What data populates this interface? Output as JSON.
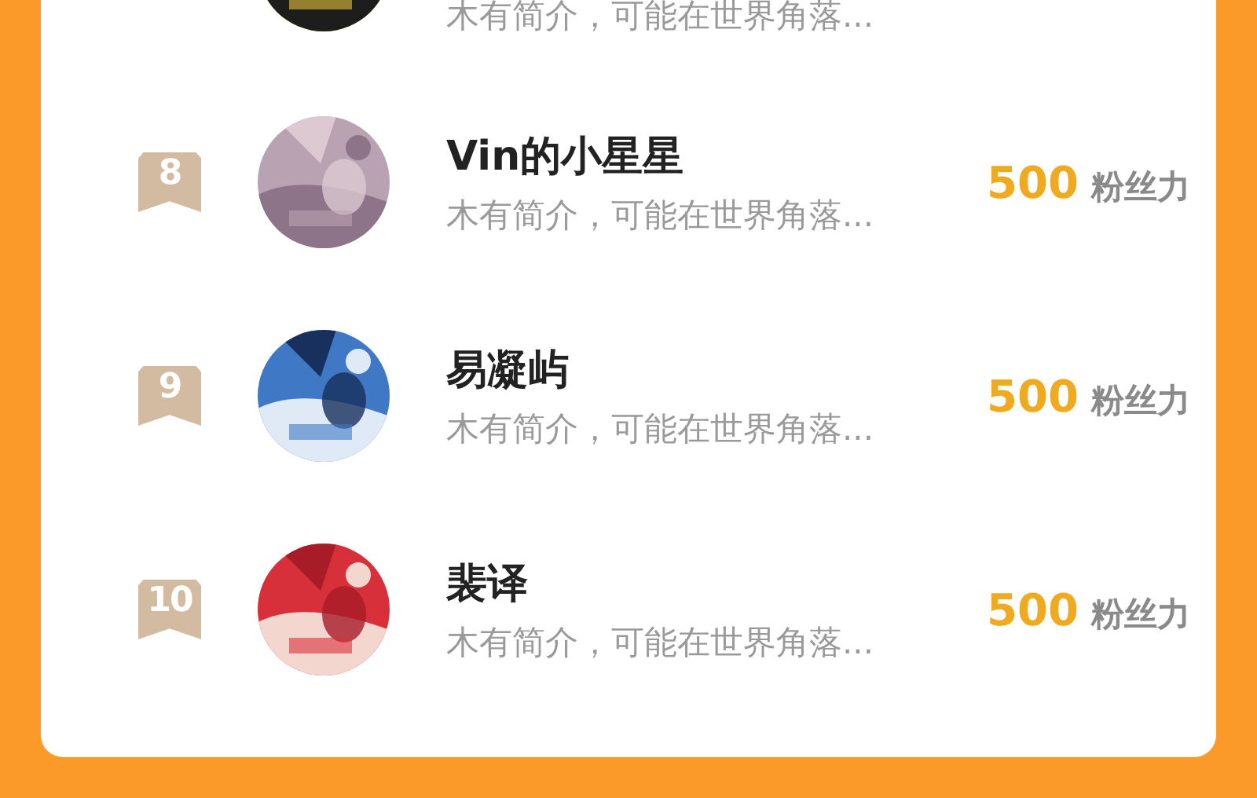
{
  "rows": [
    {
      "bio": "木有简介，可能在世界角落..."
    },
    {
      "rank": "8",
      "name": "Vin的小星星",
      "bio": "木有简介，可能在世界角落...",
      "score": "500",
      "score_unit": "粉丝力"
    },
    {
      "rank": "9",
      "name": "易凝屿",
      "bio": "木有简介，可能在世界角落...",
      "score": "500",
      "score_unit": "粉丝力"
    },
    {
      "rank": "10",
      "name": "裴译",
      "bio": "木有简介，可能在世界角落...",
      "score": "500",
      "score_unit": "粉丝力"
    }
  ]
}
